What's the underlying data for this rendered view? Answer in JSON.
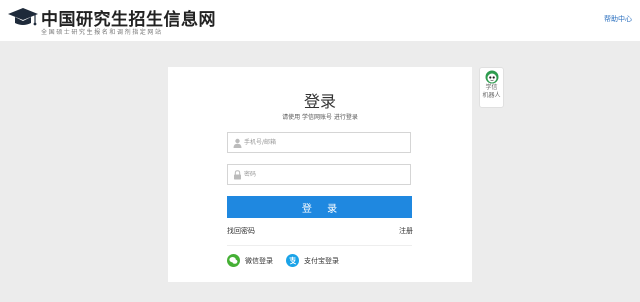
{
  "header": {
    "site_title": "中国研究生招生信息网",
    "site_subtitle": "全国硕士研究生报名和调剂指定网站",
    "help_link": "帮助中心"
  },
  "robot": {
    "label_line1": "学信",
    "label_line2": "机器人"
  },
  "login": {
    "title": "登录",
    "subtitle": "请使用 学信网账号 进行登录",
    "phone_placeholder": "手机号/邮箱",
    "password_placeholder": "密码",
    "submit_label": "登 录",
    "forgot_password": "找回密码",
    "register": "注册",
    "wechat_login": "微信登录",
    "alipay_login": "支付宝登录"
  },
  "colors": {
    "primary_button": "#1f88e0",
    "wechat": "#45b035",
    "alipay": "#1aa3e8",
    "link": "#2a6fbf"
  },
  "icons": [
    "graduation-cap-icon",
    "robot-icon",
    "user-icon",
    "lock-icon",
    "wechat-icon",
    "alipay-icon"
  ]
}
